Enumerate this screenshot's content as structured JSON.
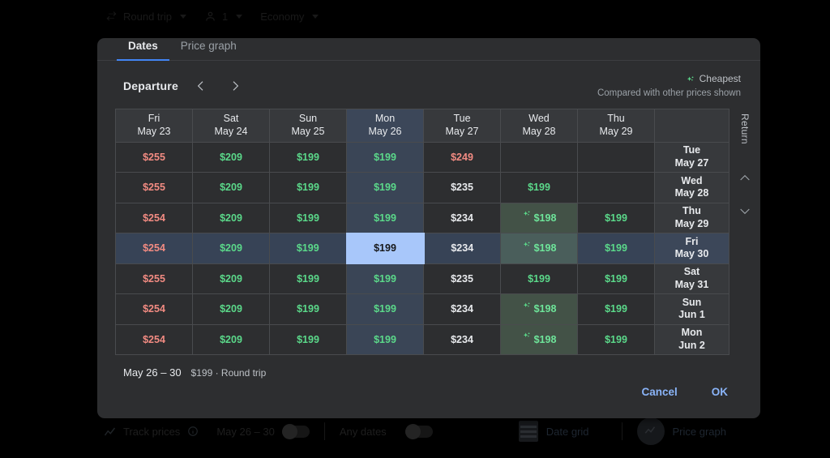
{
  "background_top_bar": {
    "trip_type": {
      "icon": "swap-arrows-icon",
      "label": "Round trip"
    },
    "passengers": {
      "icon": "person-icon",
      "label": "1"
    },
    "cabin_class": {
      "label": "Economy"
    }
  },
  "background_bottom_bar": {
    "track_prices": {
      "icon": "trend-line-icon",
      "label": "Track prices",
      "info_icon": "info-icon"
    },
    "track_dates_label": "May 26 – 30",
    "any_dates_label": "Any dates",
    "date_grid_label": "Date grid",
    "price_graph_label": "Price graph"
  },
  "dialog": {
    "tabs": [
      {
        "label": "Dates",
        "active": true
      },
      {
        "label": "Price graph",
        "active": false
      }
    ],
    "departure": {
      "label": "Departure",
      "prev_icon": "chevron-left-icon",
      "next_icon": "chevron-right-icon"
    },
    "legend": {
      "icon": "sparkle-icon",
      "title": "Cheapest",
      "subtitle": "Compared with other prices shown"
    },
    "return_rail": {
      "label": "Return",
      "up_icon": "chevron-up-icon",
      "down_icon": "chevron-down-icon"
    },
    "columns": [
      {
        "weekday": "Fri",
        "date": "May 23",
        "selected": false
      },
      {
        "weekday": "Sat",
        "date": "May 24",
        "selected": false
      },
      {
        "weekday": "Sun",
        "date": "May 25",
        "selected": false
      },
      {
        "weekday": "Mon",
        "date": "May 26",
        "selected": true
      },
      {
        "weekday": "Tue",
        "date": "May 27",
        "selected": false
      },
      {
        "weekday": "Wed",
        "date": "May 28",
        "selected": false
      },
      {
        "weekday": "Thu",
        "date": "May 29",
        "selected": false
      }
    ],
    "rows": [
      {
        "return": {
          "weekday": "Tue",
          "date": "May 27"
        },
        "selected": false,
        "cells": [
          {
            "price": "$255",
            "tier": "high"
          },
          {
            "price": "$209",
            "tier": "low"
          },
          {
            "price": "$199",
            "tier": "low"
          },
          {
            "price": "$199",
            "tier": "low"
          },
          {
            "price": "$249",
            "tier": "high"
          },
          {
            "price": "",
            "tier": "empty"
          },
          {
            "price": "",
            "tier": "empty"
          }
        ]
      },
      {
        "return": {
          "weekday": "Wed",
          "date": "May 28"
        },
        "selected": false,
        "cells": [
          {
            "price": "$255",
            "tier": "high"
          },
          {
            "price": "$209",
            "tier": "low"
          },
          {
            "price": "$199",
            "tier": "low"
          },
          {
            "price": "$199",
            "tier": "low"
          },
          {
            "price": "$235",
            "tier": "mid"
          },
          {
            "price": "$199",
            "tier": "low"
          },
          {
            "price": "",
            "tier": "empty"
          }
        ]
      },
      {
        "return": {
          "weekday": "Thu",
          "date": "May 29"
        },
        "selected": false,
        "cells": [
          {
            "price": "$254",
            "tier": "high"
          },
          {
            "price": "$209",
            "tier": "low"
          },
          {
            "price": "$199",
            "tier": "low"
          },
          {
            "price": "$199",
            "tier": "low"
          },
          {
            "price": "$234",
            "tier": "mid"
          },
          {
            "price": "$198",
            "tier": "cheapest"
          },
          {
            "price": "$199",
            "tier": "low"
          }
        ]
      },
      {
        "return": {
          "weekday": "Fri",
          "date": "May 30"
        },
        "selected": true,
        "cells": [
          {
            "price": "$254",
            "tier": "high"
          },
          {
            "price": "$209",
            "tier": "low"
          },
          {
            "price": "$199",
            "tier": "low"
          },
          {
            "price": "$199",
            "tier": "selected"
          },
          {
            "price": "$234",
            "tier": "mid"
          },
          {
            "price": "$198",
            "tier": "cheapest"
          },
          {
            "price": "$199",
            "tier": "low"
          }
        ]
      },
      {
        "return": {
          "weekday": "Sat",
          "date": "May 31"
        },
        "selected": false,
        "cells": [
          {
            "price": "$255",
            "tier": "high"
          },
          {
            "price": "$209",
            "tier": "low"
          },
          {
            "price": "$199",
            "tier": "low"
          },
          {
            "price": "$199",
            "tier": "low"
          },
          {
            "price": "$235",
            "tier": "mid"
          },
          {
            "price": "$199",
            "tier": "low"
          },
          {
            "price": "$199",
            "tier": "low"
          }
        ]
      },
      {
        "return": {
          "weekday": "Sun",
          "date": "Jun 1"
        },
        "selected": false,
        "cells": [
          {
            "price": "$254",
            "tier": "high"
          },
          {
            "price": "$209",
            "tier": "low"
          },
          {
            "price": "$199",
            "tier": "low"
          },
          {
            "price": "$199",
            "tier": "low"
          },
          {
            "price": "$234",
            "tier": "mid"
          },
          {
            "price": "$198",
            "tier": "cheapest"
          },
          {
            "price": "$199",
            "tier": "low"
          }
        ]
      },
      {
        "return": {
          "weekday": "Mon",
          "date": "Jun 2"
        },
        "selected": false,
        "cells": [
          {
            "price": "$254",
            "tier": "high"
          },
          {
            "price": "$209",
            "tier": "low"
          },
          {
            "price": "$199",
            "tier": "low"
          },
          {
            "price": "$199",
            "tier": "low"
          },
          {
            "price": "$234",
            "tier": "mid"
          },
          {
            "price": "$198",
            "tier": "cheapest"
          },
          {
            "price": "$199",
            "tier": "low"
          }
        ]
      }
    ],
    "summary": {
      "dates": "May 26 – 30",
      "detail": "$199 · Round trip"
    },
    "actions": {
      "cancel": "Cancel",
      "ok": "OK"
    }
  },
  "colors": {
    "accent_blue": "#8ab4f8",
    "selected_cell": "#a8c7fa",
    "price_low": "#5bd98a",
    "price_high": "#f28b82",
    "price_cheapest_bg": "#435247",
    "dialog_bg": "#2d2e30",
    "tab_underline": "#4285f4"
  }
}
